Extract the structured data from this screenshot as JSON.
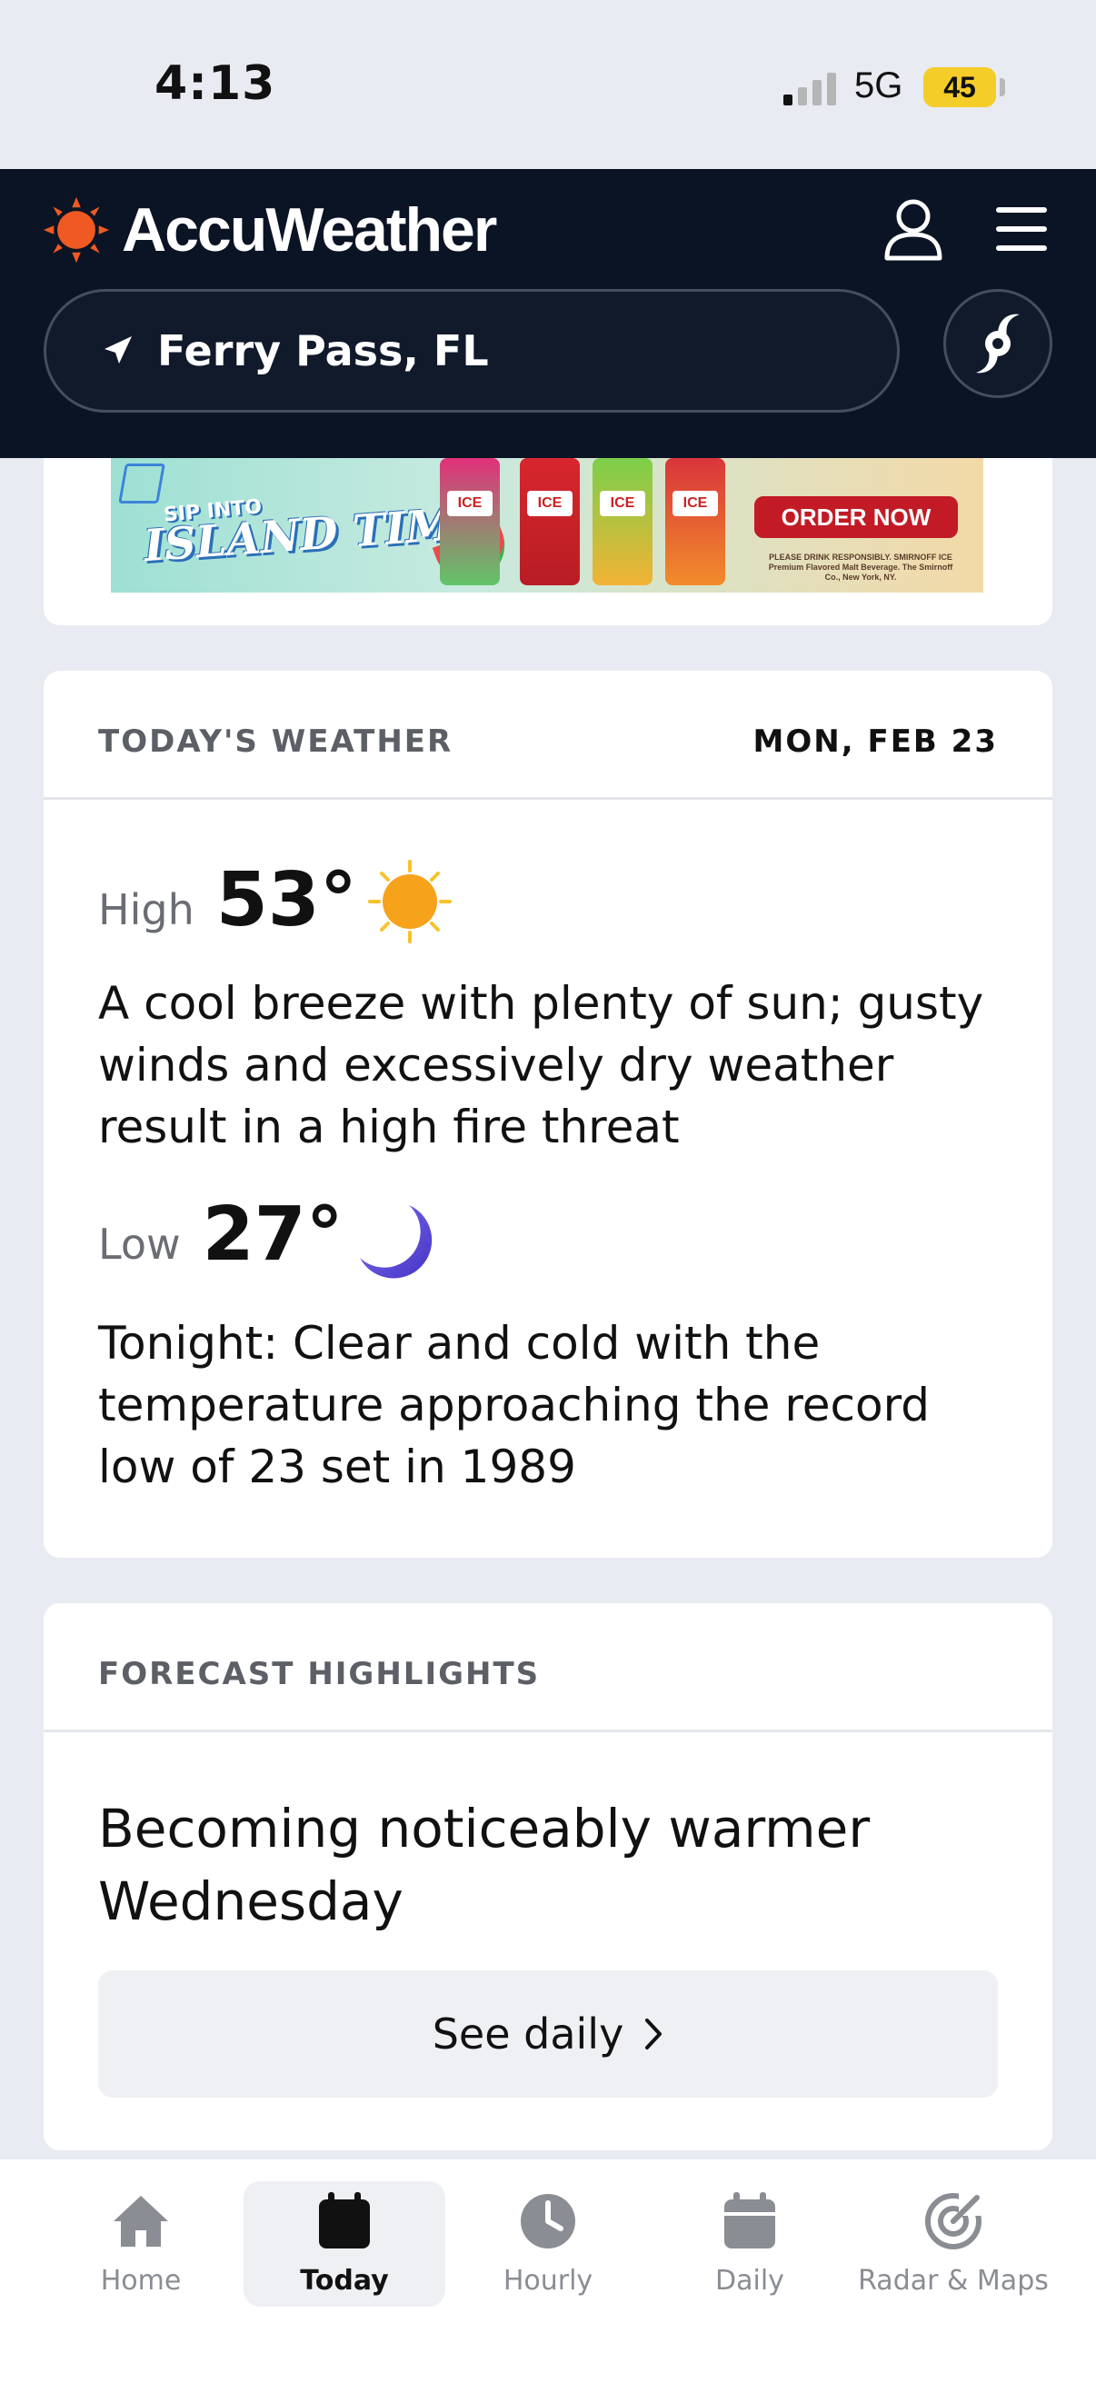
{
  "status_bar": {
    "time": "4:13",
    "network": "5G",
    "battery": "45"
  },
  "header": {
    "brand": "AccuWeather",
    "location": "Ferry Pass, FL",
    "icons": [
      "sun-logo-icon",
      "profile-icon",
      "menu-icon",
      "location-arrow-icon",
      "hurricane-icon"
    ]
  },
  "ad": {
    "subline": "SIP INTO",
    "headline": "ISLAND TIME",
    "can_label": "ICE",
    "cta": "ORDER NOW",
    "fine_print": "PLEASE DRINK RESPONSIBLY. SMIRNOFF ICE Premium Flavored Malt Beverage. The Smirnoff Co., New York, NY."
  },
  "todays_weather": {
    "section_label": "TODAY'S WEATHER",
    "date": "MON, FEB 23",
    "high_label": "High",
    "high_temp": "53°",
    "high_desc": "A cool breeze with plenty of sun; gusty winds and excessively dry weather result in a high fire threat",
    "low_label": "Low",
    "low_temp": "27°",
    "low_desc": "Tonight: Clear and cold with the temperature approaching the record low of 23 set in 1989",
    "high_icon": "sun-icon",
    "low_icon": "moon-icon"
  },
  "forecast_highlights": {
    "section_label": "FORECAST HIGHLIGHTS",
    "text": "Becoming noticeably warmer Wednesday",
    "button_label": "See daily"
  },
  "tabs": [
    {
      "label": "Home",
      "icon": "home-icon",
      "active": false
    },
    {
      "label": "Today",
      "icon": "calendar-day-icon",
      "active": true
    },
    {
      "label": "Hourly",
      "icon": "clock-icon",
      "active": false
    },
    {
      "label": "Daily",
      "icon": "calendar-icon",
      "active": false
    },
    {
      "label": "Radar & Maps",
      "icon": "radar-icon",
      "active": false
    }
  ],
  "colors": {
    "header_bg": "#0b1424",
    "page_bg": "#e9ebf2",
    "brand_orange": "#f05a22",
    "moon_purple": "#5b4fd6",
    "sun_orange": "#f7a21b",
    "battery_yellow": "#f5cd29"
  }
}
